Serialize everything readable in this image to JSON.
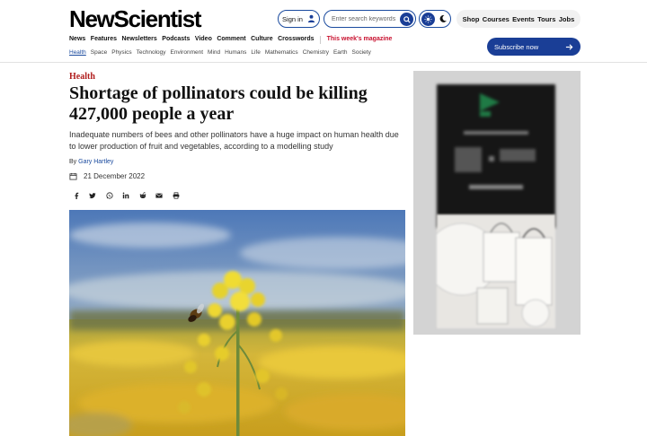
{
  "brand": {
    "logo": "NewScientist",
    "accent": "#1a3e96",
    "mag_color": "#c8102e"
  },
  "header": {
    "signin_label": "Sign in",
    "search_placeholder": "Enter search keywords",
    "toplinks": [
      "Shop",
      "Courses",
      "Events",
      "Tours",
      "Jobs"
    ],
    "subscribe_label": "Subscribe now"
  },
  "mainnav": [
    "News",
    "Features",
    "Newsletters",
    "Podcasts",
    "Video",
    "Comment",
    "Culture",
    "Crosswords"
  ],
  "magazine_label": "This week's magazine",
  "subnav": [
    "Health",
    "Space",
    "Physics",
    "Technology",
    "Environment",
    "Mind",
    "Humans",
    "Life",
    "Mathematics",
    "Chemistry",
    "Earth",
    "Society"
  ],
  "article": {
    "kicker": "Health",
    "headline": "Shortage of pollinators could be killing 427,000 people a year",
    "standfirst": "Inadequate numbers of bees and other pollinators have a huge impact on human health due to lower production of fruit and vegetables, according to a modelling study",
    "byline_prefix": "By",
    "author": "Gary Hartley",
    "date": "21 December 2022",
    "share_icons": [
      "facebook-icon",
      "twitter-icon",
      "whatsapp-icon",
      "linkedin-icon",
      "reddit-icon",
      "email-icon",
      "print-icon"
    ]
  }
}
